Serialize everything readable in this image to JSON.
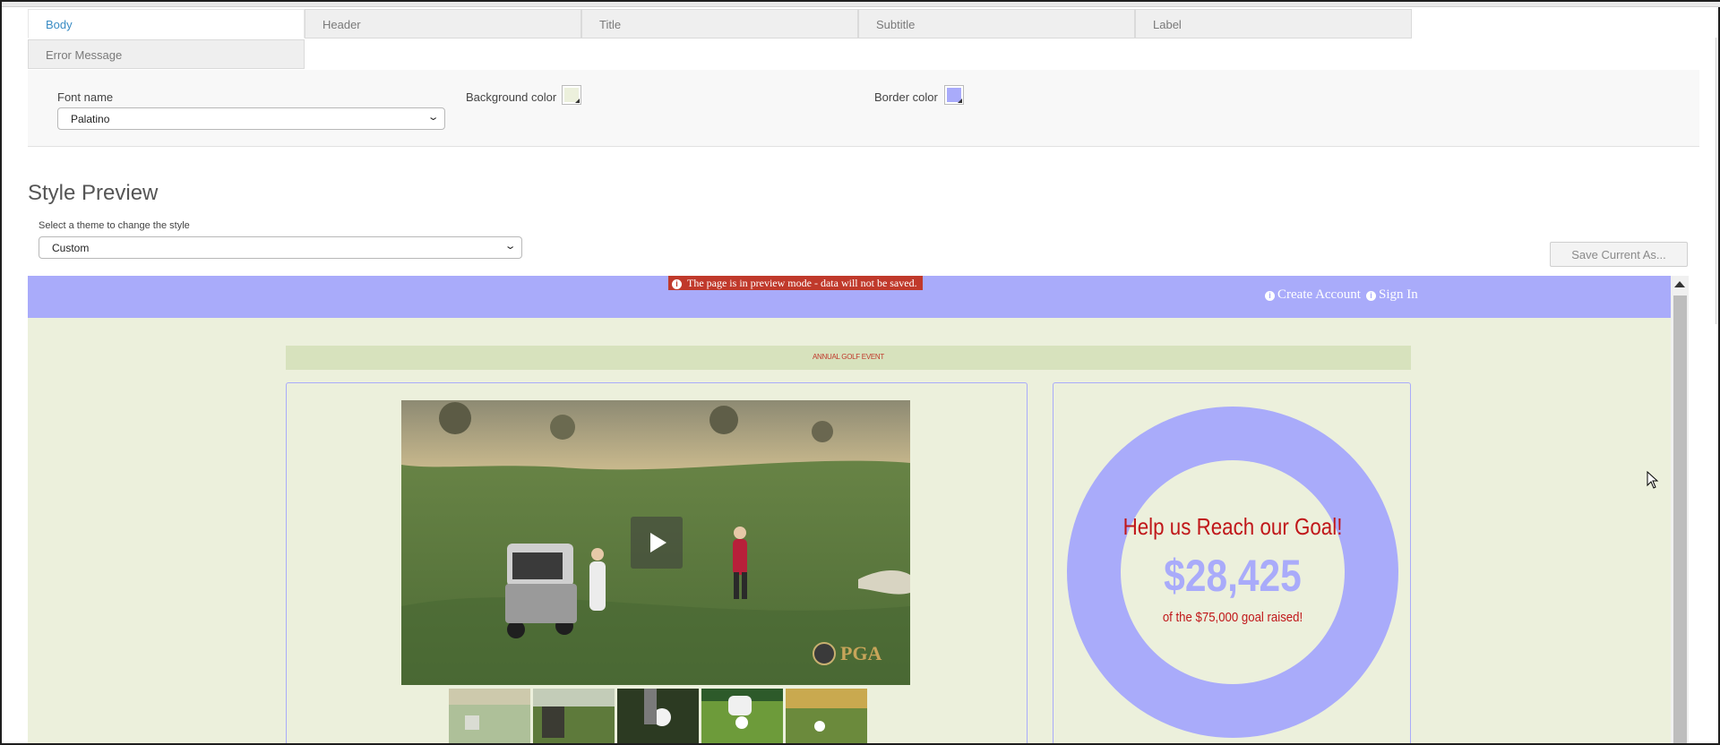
{
  "tabs": [
    {
      "label": "Body",
      "active": true
    },
    {
      "label": "Header"
    },
    {
      "label": "Title"
    },
    {
      "label": "Subtitle"
    },
    {
      "label": "Label"
    },
    {
      "label": "Error Message"
    }
  ],
  "settings": {
    "font_name_label": "Font name",
    "font_name_value": "Palatino",
    "background_color_label": "Background color",
    "background_color": "#ecf0dc",
    "border_color_label": "Border color",
    "border_color": "#a9abfa"
  },
  "preview": {
    "heading": "Style Preview",
    "theme_label": "Select a theme to change the style",
    "theme_value": "Custom",
    "save_button": "Save Current As..."
  },
  "site": {
    "banner": "The page is in preview mode - data will not be saved.",
    "create_account": "Create Account",
    "sign_in": "Sign In",
    "event_title": "ANNUAL GOLF EVENT",
    "goal_title": "Help us Reach our Goal!",
    "goal_amount": "$28,425",
    "goal_subtitle": "of the $75,000 goal raised!",
    "accent_color": "#a9abfa",
    "text_color": "#c0171a"
  },
  "icons": [
    "info-icon",
    "chevron-down-icon",
    "play-icon",
    "cursor-icon"
  ]
}
